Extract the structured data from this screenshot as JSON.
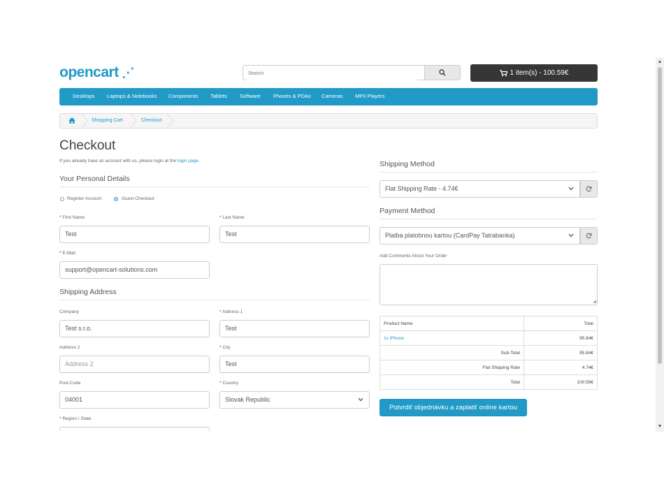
{
  "header": {
    "logo_text": "opencart",
    "search_placeholder": "Search",
    "cart_label": "1 item(s) - 100.59€"
  },
  "menu": {
    "items": [
      "Desktops",
      "Laptops & Notebooks",
      "Components",
      "Tablets",
      "Software",
      "Phones & PDAs",
      "Cameras",
      "MP3 Players"
    ]
  },
  "breadcrumb": {
    "items": [
      "Shopping Cart",
      "Checkout"
    ]
  },
  "page": {
    "title": "Checkout",
    "login_prefix": "If you already have an account with us, please login at the ",
    "login_link": "login page",
    "login_suffix": "."
  },
  "personal": {
    "legend": "Your Personal Details",
    "register_label": "Register Account",
    "guest_label": "Guest Checkout",
    "checkout_mode": "guest",
    "first_name_label": "First Name",
    "first_name_value": "Test",
    "last_name_label": "Last Name",
    "last_name_value": "Test",
    "email_label": "E-Mail",
    "email_value": "support@opencart-solutions.com"
  },
  "shipping_address": {
    "legend": "Shipping Address",
    "company_label": "Company",
    "company_value": "Test s.r.o.",
    "address1_label": "Address 1",
    "address1_value": "Test",
    "address2_label": "Address 2",
    "address2_placeholder": "Address 2",
    "city_label": "City",
    "city_value": "Test",
    "postcode_label": "Post Code",
    "postcode_value": "04001",
    "country_label": "Country",
    "country_value": "Slovak Republic",
    "region_label": "Region / State"
  },
  "shipping_method": {
    "legend": "Shipping Method",
    "value": "Flat Shipping Rate - 4.74€"
  },
  "payment_method": {
    "legend": "Payment Method",
    "value": "Platba platobnou kartou (CardPay Tatrabanka)"
  },
  "comments": {
    "label": "Add Comments About Your Order"
  },
  "summary": {
    "header_product": "Product Name",
    "header_total": "Total",
    "product_qty": "1x",
    "product_name": "iPhone",
    "product_total": "95.84€",
    "subtotal_label": "Sub-Total",
    "subtotal_value": "95.84€",
    "shipping_label": "Flat Shipping Rate",
    "shipping_value": "4.74€",
    "total_label": "Total",
    "total_value": "100.59€"
  },
  "confirm": {
    "label": "Potvrdiť objednávku a zaplatiť online kartou"
  },
  "colors": {
    "accent": "#229ac8",
    "dark_button": "#363636",
    "required": "#ff0000"
  }
}
